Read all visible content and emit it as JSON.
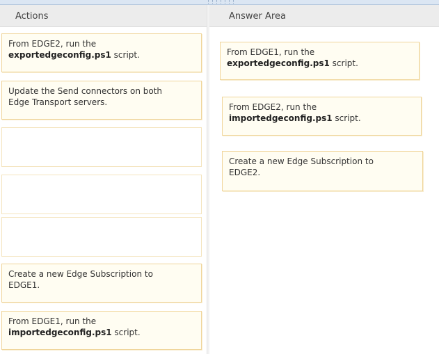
{
  "actions_panel": {
    "title": "Actions",
    "items": [
      {
        "line1": "From EDGE2, run the",
        "bold": "exportedgeconfig.ps1",
        "suffix": " script."
      },
      {
        "line1": "Update the Send connectors on both",
        "line2": "Edge Transport servers."
      },
      {
        "empty": true
      },
      {
        "empty": true
      },
      {
        "empty": true
      },
      {
        "line1": "Create a new Edge Subscription to",
        "line2": "EDGE1."
      },
      {
        "line1": "From EDGE1, run the",
        "bold": "importedgeconfig.ps1",
        "suffix": " script."
      }
    ]
  },
  "answer_panel": {
    "title": "Answer Area",
    "items": [
      {
        "line1": "From EDGE1, run the",
        "bold": "exportedgeconfig.ps1",
        "suffix": " script."
      },
      {
        "line1": "From EDGE2, run the",
        "bold": "importedgeconfig.ps1",
        "suffix": " script."
      },
      {
        "line1": "Create a new Edge Subscription to",
        "line2": "EDGE2."
      }
    ]
  },
  "splitter": {
    "grip_icon": "drag-grip-icon"
  }
}
